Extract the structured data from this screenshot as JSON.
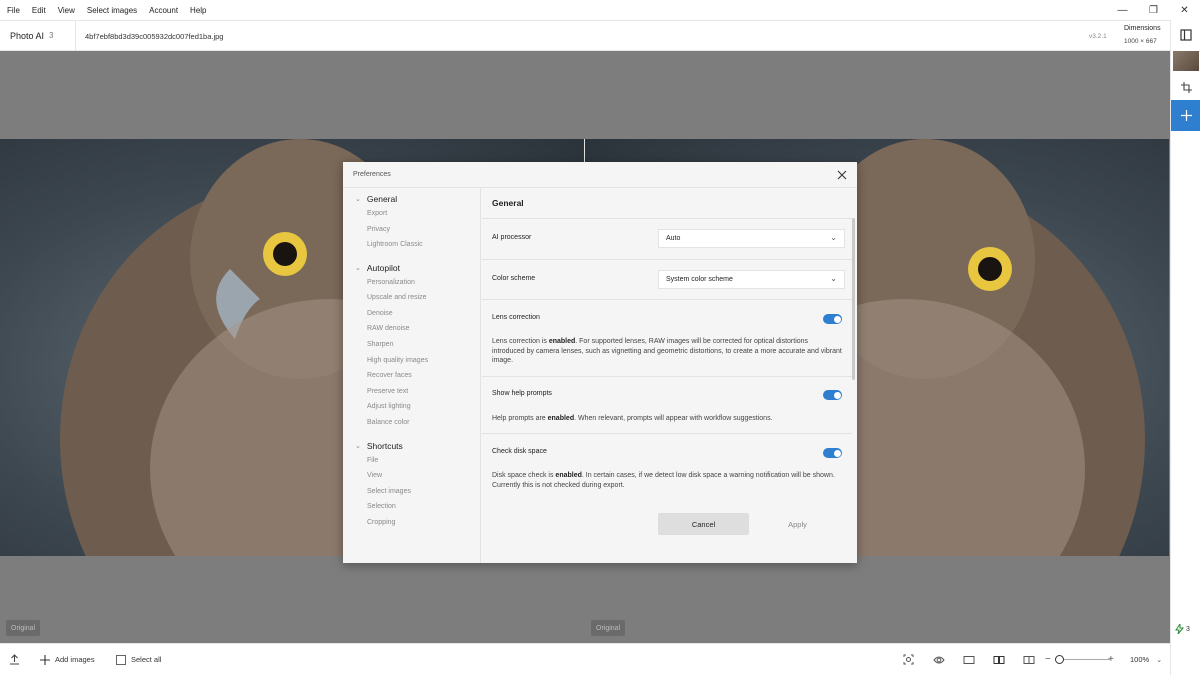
{
  "menubar": {
    "items": [
      "File",
      "Edit",
      "View",
      "Select images",
      "Account",
      "Help"
    ]
  },
  "window_controls": {
    "minimize": "—",
    "restore": "❐",
    "close": "✕"
  },
  "header": {
    "app_name": "Photo AI",
    "count": "3",
    "filename": "4bf7ebf8bd3d39c005932dc007fed1ba.jpg",
    "version": "v3.2.1",
    "dimensions_label": "Dimensions",
    "dimensions_value": "1000 × 667"
  },
  "workspace": {
    "left_badge": "Original",
    "right_badge": "Original"
  },
  "rail": {
    "bottom_count": "3"
  },
  "bottombar": {
    "add_images": "Add images",
    "select_all": "Select all",
    "zoom": "100%"
  },
  "modal": {
    "title": "Preferences",
    "nav": [
      {
        "section": "General",
        "items": [
          "Export",
          "Privacy",
          "Lightroom Classic"
        ]
      },
      {
        "section": "Autopilot",
        "items": [
          "Personalization",
          "Upscale and resize",
          "Denoise",
          "RAW denoise",
          "Sharpen",
          "High quality images",
          "Recover faces",
          "Preserve text",
          "Adjust lighting",
          "Balance color"
        ]
      },
      {
        "section": "Shortcuts",
        "items": [
          "File",
          "View",
          "Select images",
          "Selection",
          "Cropping"
        ]
      }
    ],
    "content": {
      "title": "General",
      "ai_processor": {
        "label": "AI processor",
        "value": "Auto"
      },
      "color_scheme": {
        "label": "Color scheme",
        "value": "System color scheme"
      },
      "lens_correction": {
        "label": "Lens correction",
        "enabled": true,
        "desc_pre": "Lens correction is ",
        "desc_bold": "enabled",
        "desc_post": ". For supported lenses, RAW images will be corrected for optical distortions introduced by camera lenses, such as vignetting and geometric distortions, to create a more accurate and vibrant image."
      },
      "help_prompts": {
        "label": "Show help prompts",
        "enabled": true,
        "desc_pre": "Help prompts are ",
        "desc_bold": "enabled",
        "desc_post": ". When relevant, prompts will appear with workflow suggestions."
      },
      "disk_space": {
        "label": "Check disk space",
        "enabled": true,
        "desc_pre": "Disk space check is ",
        "desc_bold": "enabled",
        "desc_post": ". In certain cases, if we detect low disk space a warning notification will be shown. Currently this is not checked during export."
      }
    },
    "cancel": "Cancel",
    "apply": "Apply"
  },
  "colors": {
    "accent": "#2f7fd1",
    "workspace_bg": "#7d7d7d"
  }
}
